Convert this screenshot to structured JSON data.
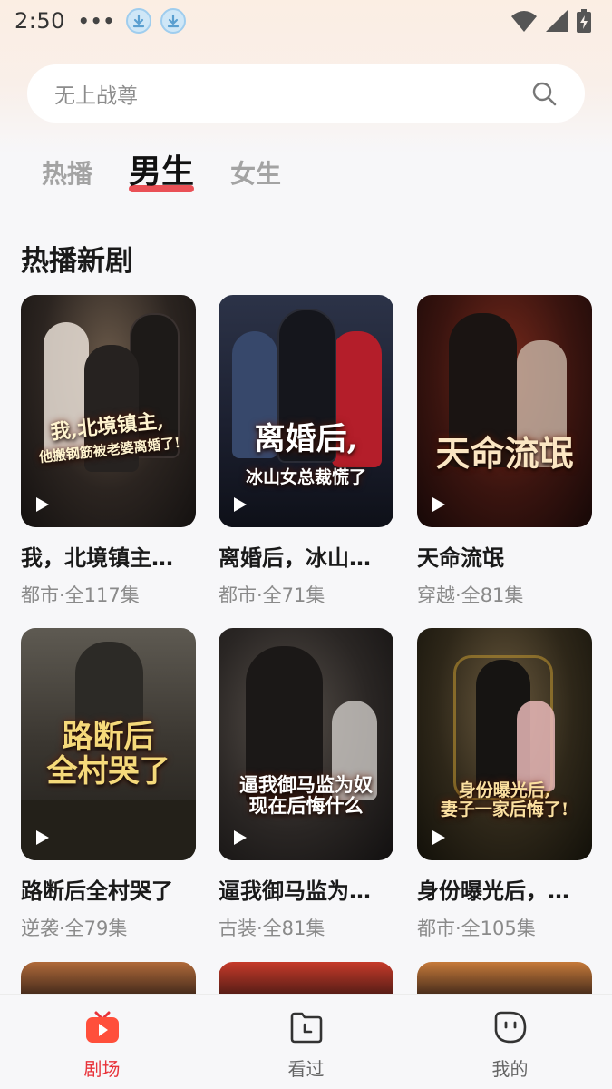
{
  "status": {
    "time": "2:50",
    "dots": "•••",
    "icons": [
      "download-icon",
      "download-icon",
      "wifi-icon",
      "signal-icon",
      "battery-charging-icon"
    ]
  },
  "search": {
    "placeholder": "无上战尊"
  },
  "tabs": [
    {
      "label": "热播",
      "active": false
    },
    {
      "label": "男生",
      "active": true
    },
    {
      "label": "女生",
      "active": false
    }
  ],
  "section": {
    "title": "热播新剧"
  },
  "dramas": [
    {
      "title": "我，北境镇主…",
      "meta": "都市·全117集",
      "poster_text": "我,北境镇主,\n他搬钢筋被老婆离婚了!"
    },
    {
      "title": "离婚后，冰山…",
      "meta": "都市·全71集",
      "poster_text": "离婚后,\n冰山女总裁慌了"
    },
    {
      "title": "天命流氓",
      "meta": "穿越·全81集",
      "poster_text": "天命流氓"
    },
    {
      "title": "路断后全村哭了",
      "meta": "逆袭·全79集",
      "poster_text": "路断后\n全村哭了"
    },
    {
      "title": "逼我御马监为…",
      "meta": "古装·全81集",
      "poster_text": "逼我御马监为奴\n现在后悔什么"
    },
    {
      "title": "身份曝光后，…",
      "meta": "都市·全105集",
      "poster_text": "身份曝光后,\n妻子一家后悔了!"
    }
  ],
  "bottom_nav": [
    {
      "label": "剧场",
      "icon": "tv-icon",
      "active": true
    },
    {
      "label": "看过",
      "icon": "history-folder-icon",
      "active": false
    },
    {
      "label": "我的",
      "icon": "profile-face-icon",
      "active": false
    }
  ],
  "colors": {
    "accent": "#e8333a",
    "background": "#f7f7f9"
  }
}
